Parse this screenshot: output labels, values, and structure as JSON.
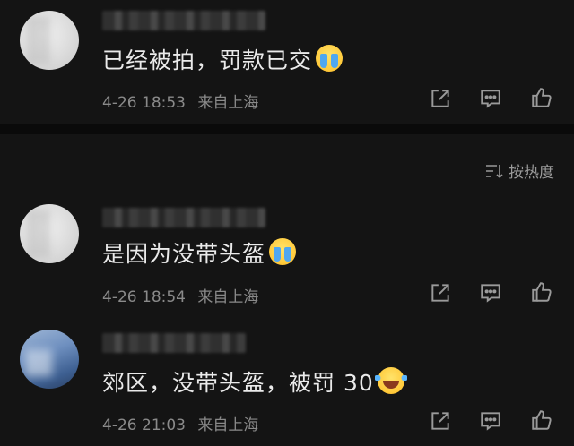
{
  "comments": [
    {
      "text": "已经被拍，罚款已交",
      "emoji": "crying-face-emoji",
      "date": "4-26",
      "time": "18:53",
      "location": "来自上海"
    },
    {
      "text": "是因为没带头盔",
      "emoji": "crying-face-emoji",
      "date": "4-26",
      "time": "18:54",
      "location": "来自上海"
    },
    {
      "text": "郊区，没带头盔，被罚 30",
      "emoji": "tears-of-joy-emoji",
      "date": "4-26",
      "time": "21:03",
      "location": "来自上海"
    }
  ],
  "sort": {
    "label": "按热度",
    "icon": "sort-icon"
  },
  "actions": [
    "share-icon",
    "comment-icon",
    "like-icon"
  ],
  "colors": {
    "background": "#141414",
    "text": "#eaeaea",
    "meta": "#8a8a8a",
    "divider": "#0a0a0a"
  }
}
